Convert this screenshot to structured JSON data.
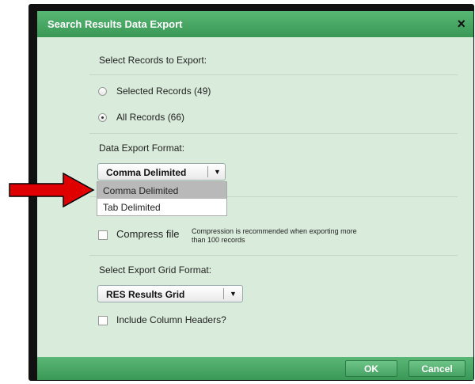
{
  "dialog": {
    "title": "Search Results Data Export",
    "close_label": "×"
  },
  "records": {
    "heading": "Select Records to Export:",
    "options": [
      {
        "label": "Selected Records (49)",
        "selected": false
      },
      {
        "label": "All Records (66)",
        "selected": true
      }
    ]
  },
  "format": {
    "heading": "Data Export Format:",
    "selected": "Comma Delimited",
    "options": [
      "Comma Delimited",
      "Tab Delimited"
    ],
    "highlighted_option": "Comma Delimited"
  },
  "compress": {
    "label": "Compress file",
    "checked": false,
    "note_line1": "Compression is recommended when exporting more",
    "note_line2": "than 100 records"
  },
  "grid": {
    "heading": "Select Export Grid Format:",
    "selected": "RES Results Grid",
    "include_headers_label": "Include Column Headers?",
    "include_headers_checked": false
  },
  "footer": {
    "ok_label": "OK",
    "cancel_label": "Cancel"
  },
  "colors": {
    "title_bar": "#4aaa66",
    "panel_bg": "#d9ebdb",
    "annotation_arrow": "#e00000"
  }
}
